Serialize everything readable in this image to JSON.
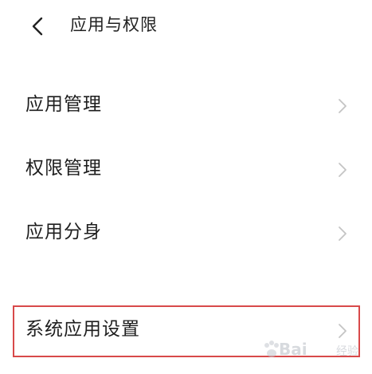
{
  "header": {
    "title": "应用与权限",
    "back_icon": "chevron-left-icon"
  },
  "items": [
    {
      "label": "应用管理",
      "icon": "chevron-right-icon"
    },
    {
      "label": "权限管理",
      "icon": "chevron-right-icon"
    },
    {
      "label": "应用分身",
      "icon": "chevron-right-icon"
    },
    {
      "label": "系统应用设置",
      "icon": "chevron-right-icon",
      "highlighted": true
    }
  ],
  "colors": {
    "highlight_border": "#d8494a",
    "chevron": "#c4c4c4",
    "text": "#1e1e1e",
    "background": "#ffffff"
  },
  "watermark": {
    "text": "Bai",
    "sub": "经验"
  }
}
